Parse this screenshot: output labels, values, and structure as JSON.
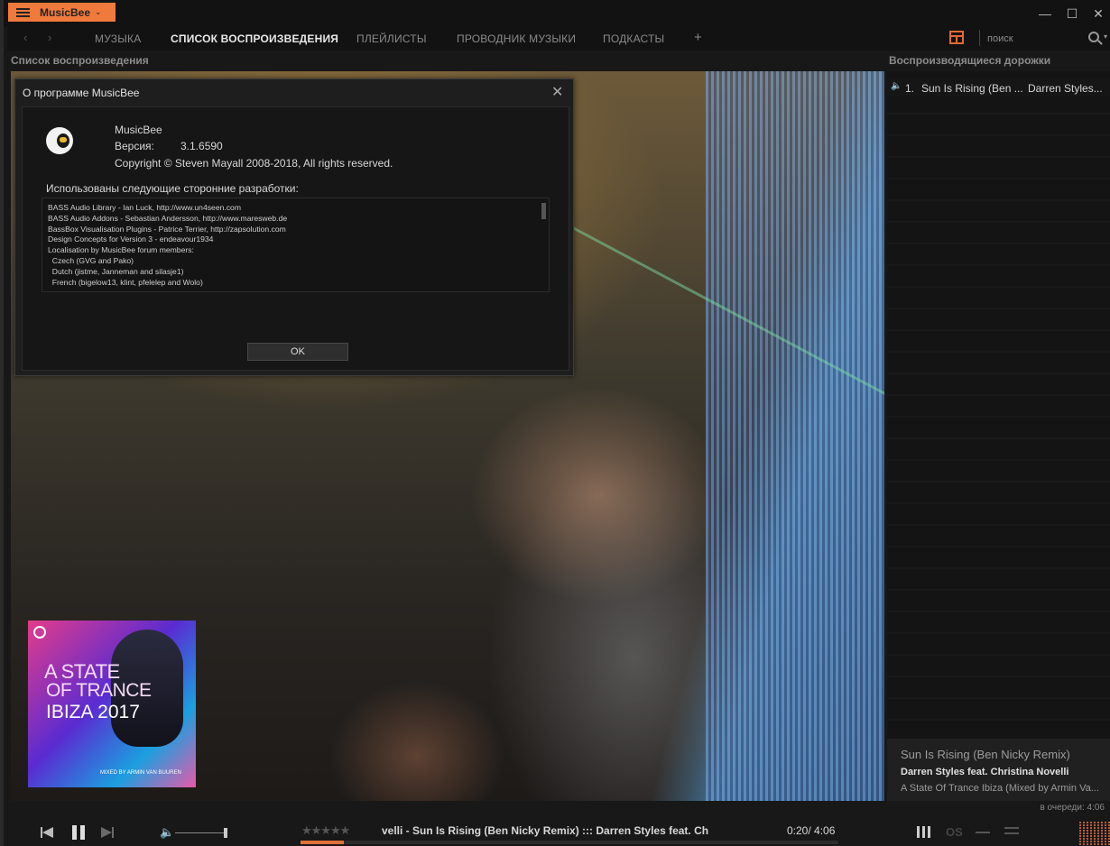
{
  "titlebar": {
    "app_name": "MusicBee",
    "caret": "⌄",
    "minimize": "—",
    "maximize": "☐",
    "close": "✕"
  },
  "nav": {
    "back": "‹",
    "forward": "›",
    "tabs": [
      {
        "label": "МУЗЫКА",
        "active": false
      },
      {
        "label": "СПИСОК ВОСПРОИЗВЕДЕНИЯ",
        "active": true
      },
      {
        "label": "ПЛЕЙЛИСТЫ",
        "active": false
      },
      {
        "label": "ПРОВОДНИК МУЗЫКИ",
        "active": false
      },
      {
        "label": "ПОДКАСТЫ",
        "active": false
      }
    ],
    "add_tab": "+",
    "search_placeholder": "поиск",
    "search_caret": "▾"
  },
  "left_header": "Список воспроизведения",
  "right_header": "Воспроизводящиеся дорожки",
  "dialog": {
    "title": "О программе MusicBee",
    "close": "✕",
    "app_name": "MusicBee",
    "version_label": "Версия:",
    "version": "3.1.6590",
    "copyright": "Copyright © Steven Mayall 2008-2018, All rights reserved.",
    "credits_heading": "Использованы следующие сторонние разработки:",
    "credits": [
      "BASS Audio Library - Ian Luck, http://www.un4seen.com",
      "BASS Audio Addons - Sebastian Andersson, http://www.maresweb.de",
      "BassBox Visualisation Plugins - Patrice Terrier, http://zapsolution.com",
      "Design Concepts for Version 3 - endeavour1934",
      "Localisation by MusicBee forum members:",
      "  Czech (GVG and Pako)",
      "  Dutch (jistme, Janneman and silasje1)",
      "  French (bigelow13, klint, pfelelep and Wolo)"
    ],
    "ok_label": "OK"
  },
  "album_art": {
    "line1": "A STATE",
    "line2": "OF TRANCE",
    "line3": "IBIZA 2017",
    "footer": "MIXED BY ARMIN VAN BUUREN"
  },
  "now_playing_list": [
    {
      "number": "1.",
      "title": "Sun Is Rising (Ben ...",
      "artist": "Darren Styles..."
    }
  ],
  "now_playing": {
    "title": "Sun Is Rising (Ben Nicky Remix)",
    "artist": "Darren Styles feat. Christina Novelli",
    "album": "A State Of Trance Ibiza (Mixed by Armin Va...",
    "queue": "в очереди: 4:06"
  },
  "player": {
    "rating": "★★★★★",
    "rating_value": 0,
    "marquee": "velli - Sun Is Rising (Ben Nicky Remix)  :::  Darren Styles feat. Ch",
    "time": "0:20/ 4:06",
    "progress": 0.081,
    "volume": 0.95,
    "os_label": "OS",
    "volume_icon": "🔈"
  },
  "colors": {
    "accent": "#f07a3c",
    "background": "#181818"
  }
}
